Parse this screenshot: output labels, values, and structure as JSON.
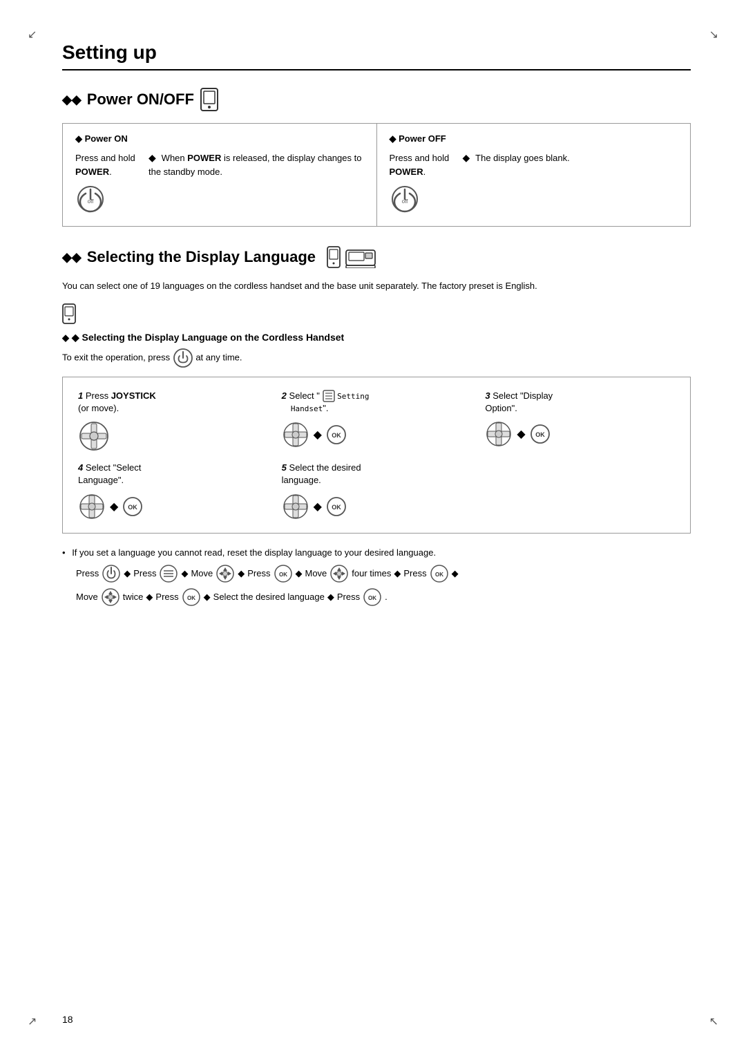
{
  "page": {
    "number": "18",
    "corner_tl": "↙",
    "corner_tr": "↘",
    "corner_bl": "↗",
    "corner_br": "↖"
  },
  "section": {
    "title": "Setting up",
    "power_heading": "Power ON/OFF",
    "power_on_label": "◆ Power ON",
    "power_off_label": "◆ Power OFF",
    "power_on_step1_text": "Press and hold POWER.",
    "power_on_step2_prefix": "When ",
    "power_on_step2_bold": "POWER",
    "power_on_step2_suffix": " is released, the display changes to the standby mode.",
    "power_off_step1_text": "Press and hold POWER.",
    "power_off_step2_text": "The display goes blank.",
    "display_lang_heading": "Selecting the Display Language",
    "display_lang_desc": "You can select one of 19 languages on the cordless handset and the base unit separately. The factory preset is English.",
    "handset_section_title": "◆ Selecting the Display Language on the Cordless Handset",
    "exit_note_prefix": "To exit the operation, press ",
    "exit_note_suffix": " at any time.",
    "steps": [
      {
        "num": "1",
        "label": "Press JOYSTICK (or move).",
        "icon_type": "nav_only"
      },
      {
        "num": "2",
        "label_prefix": "Select \"",
        "label_bold": "🎵",
        "label_mid": " Setting Handset",
        "label_suffix": "\".",
        "icon_type": "nav_ok"
      },
      {
        "num": "3",
        "label_prefix": "Select \"Display Option\".",
        "icon_type": "nav_ok"
      },
      {
        "num": "4",
        "label_prefix": "Select \"Select Language\".",
        "icon_type": "nav_ok"
      },
      {
        "num": "5",
        "label_prefix": "Select the desired language.",
        "icon_type": "nav_ok"
      }
    ],
    "bullet_note_line1": "If you set a language you cannot read, reset the display language to your desired language.",
    "seq_line1_parts": [
      "Press",
      "off_btn",
      "→",
      "Press",
      "menu_btn",
      "→",
      "Move",
      "nav_btn",
      "→",
      "Press",
      "ok_btn",
      "→",
      "Move",
      "nav_btn",
      "four times",
      "→",
      "Press",
      "ok_btn",
      "→"
    ],
    "seq_line2_parts": [
      "Move",
      "nav_btn",
      "twice",
      "→",
      "Press",
      "ok_btn",
      "→",
      "Select the desired language",
      "→",
      "Press",
      "ok_btn",
      "."
    ]
  }
}
